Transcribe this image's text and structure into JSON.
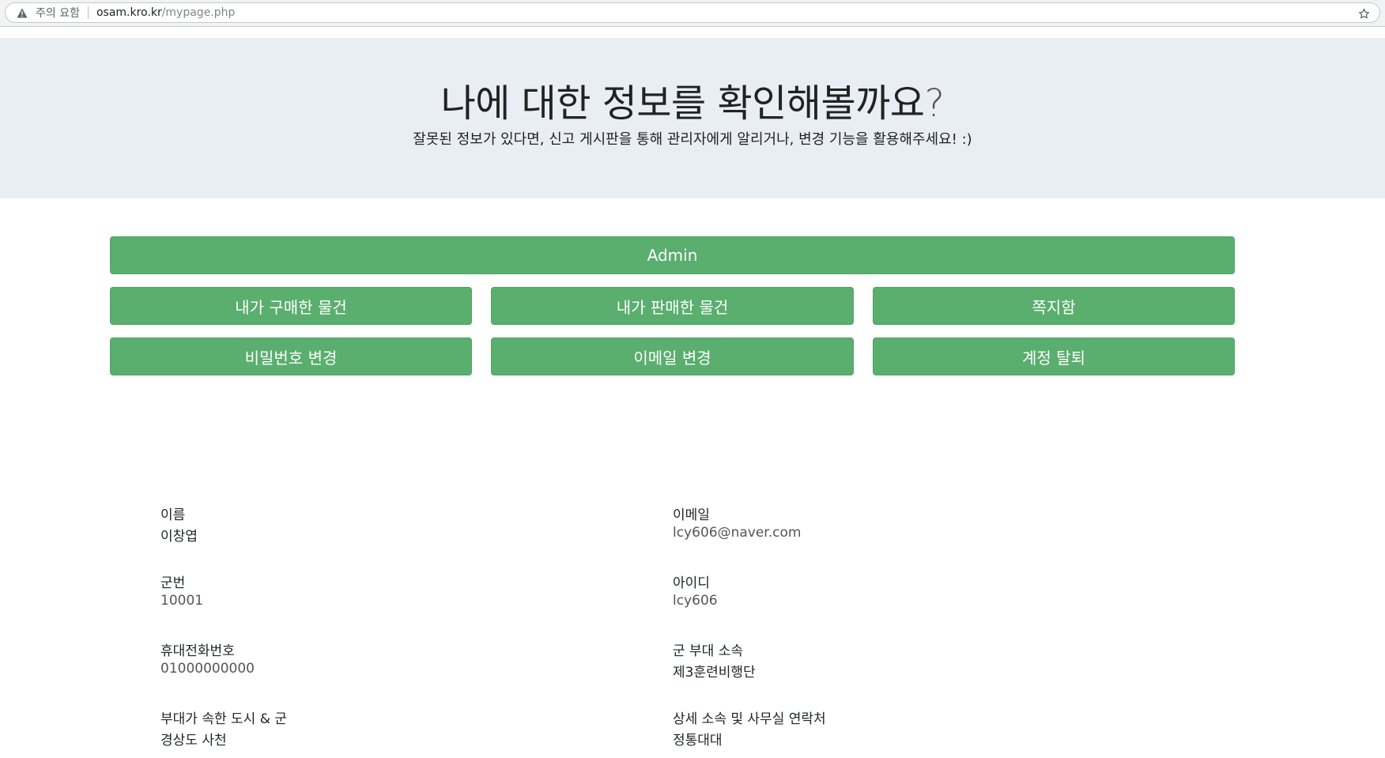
{
  "browser": {
    "security_label": "주의 요함",
    "url_host": "osam.kro.kr",
    "url_path": "/mypage.php"
  },
  "hero": {
    "title": "나에 대한 정보를 확인해볼까요",
    "title_mark": "?",
    "subtitle": "잘못된 정보가 있다면, 신고 게시판을 통해 관리자에게 알리거나, 변경 기능을 활용해주세요! :)"
  },
  "buttons": {
    "admin": "Admin",
    "purchased": "내가 구매한 물건",
    "sold": "내가 판매한 물건",
    "inbox": "쪽지함",
    "change_password": "비밀번호 변경",
    "change_email": "이메일 변경",
    "delete_account": "계정 탈퇴"
  },
  "profile": {
    "name": {
      "label": "이름",
      "value": "이창엽"
    },
    "email": {
      "label": "이메일",
      "value": "lcy606@naver.com"
    },
    "service_number": {
      "label": "군번",
      "value": "10001"
    },
    "user_id": {
      "label": "아이디",
      "value": "lcy606"
    },
    "phone": {
      "label": "휴대전화번호",
      "value": "01000000000"
    },
    "unit": {
      "label": "군 부대 소속",
      "value": "제3훈련비행단"
    },
    "city": {
      "label": "부대가 속한 도시 & 군",
      "value": "경상도 사천"
    },
    "detail": {
      "label": "상세 소속 및 사무실 연락처",
      "value": "정통대대"
    }
  },
  "colors": {
    "accent_green": "#5aae6e",
    "hero_bg": "#e9eef5"
  },
  "icons": {
    "security": "warning-triangle-icon",
    "bookmark": "star-icon"
  }
}
